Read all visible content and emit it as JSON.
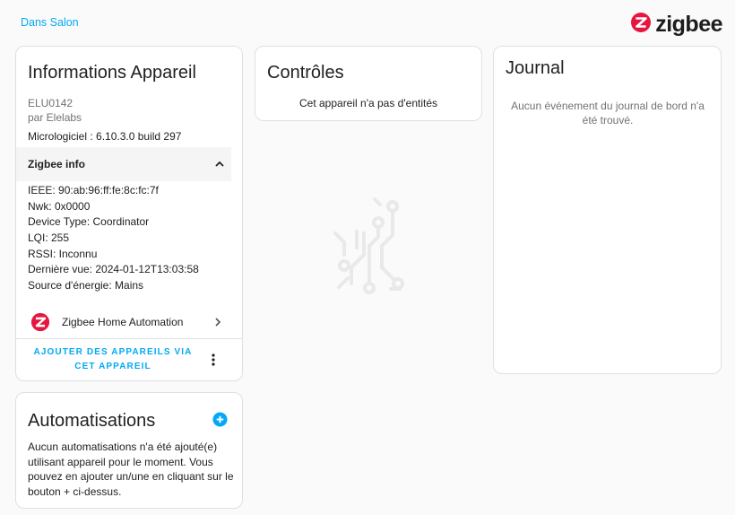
{
  "header": {
    "area_link": "Dans Salon",
    "brand": "zigbee"
  },
  "device_info": {
    "title": "Informations Appareil",
    "model": "ELU0142",
    "manufacturer": "par Elelabs",
    "firmware": "Micrologiciel : 6.10.3.0 build 297",
    "zigbee_info": {
      "header": "Zigbee info",
      "expanded": true,
      "rows": [
        "IEEE: 90:ab:96:ff:fe:8c:fc:7f",
        "Nwk: 0x0000",
        "Device Type: Coordinator",
        "LQI: 255",
        "RSSI: Inconnu",
        "Dernière vue: 2024-01-12T13:03:58",
        "Source d'énergie: Mains"
      ]
    },
    "integration_label": "Zigbee Home Automation",
    "add_devices_label": "AJOUTER DES APPAREILS VIA CET APPAREIL"
  },
  "controls": {
    "title": "Contrôles",
    "empty_text": "Cet appareil n'a pas d'entités"
  },
  "journal": {
    "title": "Journal",
    "empty_text": "Aucun événement du journal de bord n'a été trouvé."
  },
  "automations": {
    "title": "Automatisations",
    "empty_text": "Aucun automatisations n'a été ajouté(e) utilisant appareil pour le moment. Vous pouvez en ajouter un/une en cliquant sur le bouton + ci-dessus."
  },
  "colors": {
    "accent": "#03a9f4",
    "zigbee_red": "#e5173f",
    "card_border": "#e0e0e0",
    "secondary_text": "#727272"
  },
  "icons": {
    "brand": "zigbee-logo-icon",
    "collapse": "chevron-up-icon",
    "navigate": "chevron-right-icon",
    "more": "dots-vertical-icon",
    "add": "plus-circle-icon",
    "watermark": "circuit-board-icon"
  }
}
